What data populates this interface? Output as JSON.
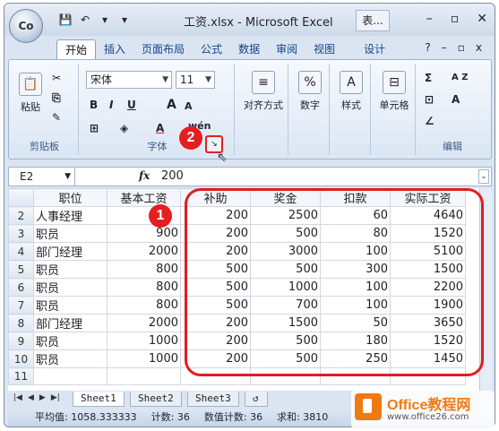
{
  "title_bar": {
    "office_button": "Co",
    "quick_access": [
      "💾",
      "↶",
      "·",
      "▾",
      "▾"
    ],
    "title": "工资.xlsx - Microsoft Excel",
    "extra_tab": "表...",
    "window_controls": [
      "–",
      "▫",
      "✕"
    ]
  },
  "tabs": [
    "开始",
    "插入",
    "页面布局",
    "公式",
    "数据",
    "审阅",
    "视图",
    "设计"
  ],
  "help_icons": [
    "?",
    "–",
    "▫",
    "x"
  ],
  "ribbon": {
    "clipboard": {
      "paste_label": "粘贴",
      "group_label": "剪贴板"
    },
    "font": {
      "font_name": "宋体",
      "font_size": "11",
      "bold": "B",
      "italic": "I",
      "underline": "U",
      "grow": "A",
      "shrink": "A",
      "color_a": "A",
      "phonetic": "wén",
      "group_label": "字体"
    },
    "alignment": {
      "label": "对齐方式"
    },
    "number": {
      "label": "数字",
      "symbol": "%"
    },
    "styles": {
      "label": "样式"
    },
    "cells": {
      "label": "单元格"
    },
    "editing": {
      "label": "编辑",
      "sigma": "Σ",
      "sort": "A Z",
      "find": "A",
      "clear": "∠"
    }
  },
  "formula_bar": {
    "name_box": "E2",
    "fx": "fx",
    "value": "200"
  },
  "annotations": {
    "badge1": "1",
    "badge2": "2"
  },
  "columns": [
    "职位",
    "基本工资",
    "补助",
    "奖金",
    "扣款",
    "实际工资"
  ],
  "rows": [
    {
      "n": "2",
      "cells": [
        "人事经理",
        "",
        "200",
        "2500",
        "60",
        "4640"
      ]
    },
    {
      "n": "3",
      "cells": [
        "职员",
        "900",
        "200",
        "500",
        "80",
        "1520"
      ]
    },
    {
      "n": "4",
      "cells": [
        "部门经理",
        "2000",
        "200",
        "3000",
        "100",
        "5100"
      ]
    },
    {
      "n": "5",
      "cells": [
        "职员",
        "800",
        "500",
        "500",
        "300",
        "1500"
      ]
    },
    {
      "n": "6",
      "cells": [
        "职员",
        "800",
        "500",
        "1000",
        "100",
        "2200"
      ]
    },
    {
      "n": "7",
      "cells": [
        "职员",
        "800",
        "500",
        "700",
        "100",
        "1900"
      ]
    },
    {
      "n": "8",
      "cells": [
        "部门经理",
        "2000",
        "200",
        "1500",
        "50",
        "3650"
      ]
    },
    {
      "n": "9",
      "cells": [
        "职员",
        "1000",
        "200",
        "500",
        "180",
        "1520"
      ]
    },
    {
      "n": "10",
      "cells": [
        "职员",
        "1000",
        "200",
        "500",
        "250",
        "1450"
      ]
    },
    {
      "n": "11",
      "cells": [
        "",
        "",
        "",
        "",
        "",
        ""
      ]
    }
  ],
  "sheets": [
    "Sheet1",
    "Sheet2",
    "Sheet3"
  ],
  "status": {
    "average": "平均值: 1058.333333",
    "count": "计数: 36",
    "num_count": "数值计数: 36",
    "sum": "求和: 3810"
  },
  "watermark": {
    "brand": "Office教程网",
    "url": "www.office26.com"
  }
}
